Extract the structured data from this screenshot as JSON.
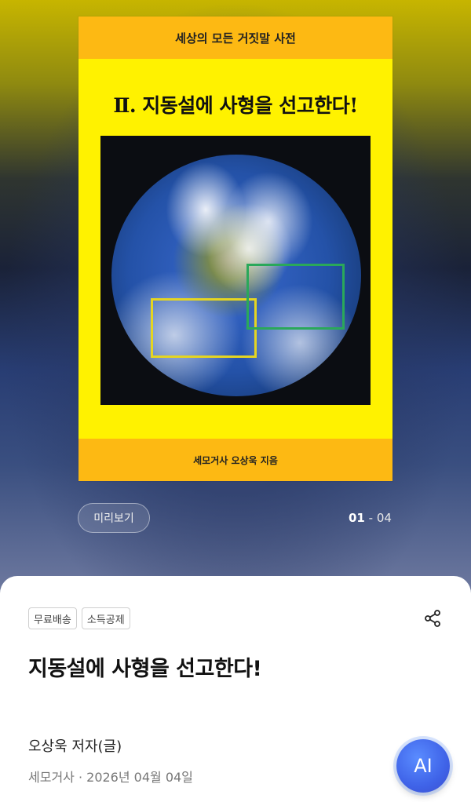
{
  "cover": {
    "series": "세상의 모든 거짓말 사전",
    "title": "Ⅱ. 지동설에 사형을 선고한다!",
    "author_line": "세모거사 오상욱 지음"
  },
  "preview": {
    "label": "미리보기"
  },
  "pager": {
    "current": "01",
    "separator": " - ",
    "total": "04"
  },
  "tags": [
    "무료배송",
    "소득공제"
  ],
  "book": {
    "title": "지동설에 사형을 선고한다!",
    "author": "오상욱 저자(글)",
    "meta": "세모거사 · 2026년 04월 04일"
  },
  "ai_button": {
    "label": "AI"
  },
  "icons": {
    "share": "share-icon"
  },
  "colors": {
    "cover_yellow": "#fff200",
    "cover_orange": "#fdb913",
    "ai_blue": "#3f63e8"
  }
}
